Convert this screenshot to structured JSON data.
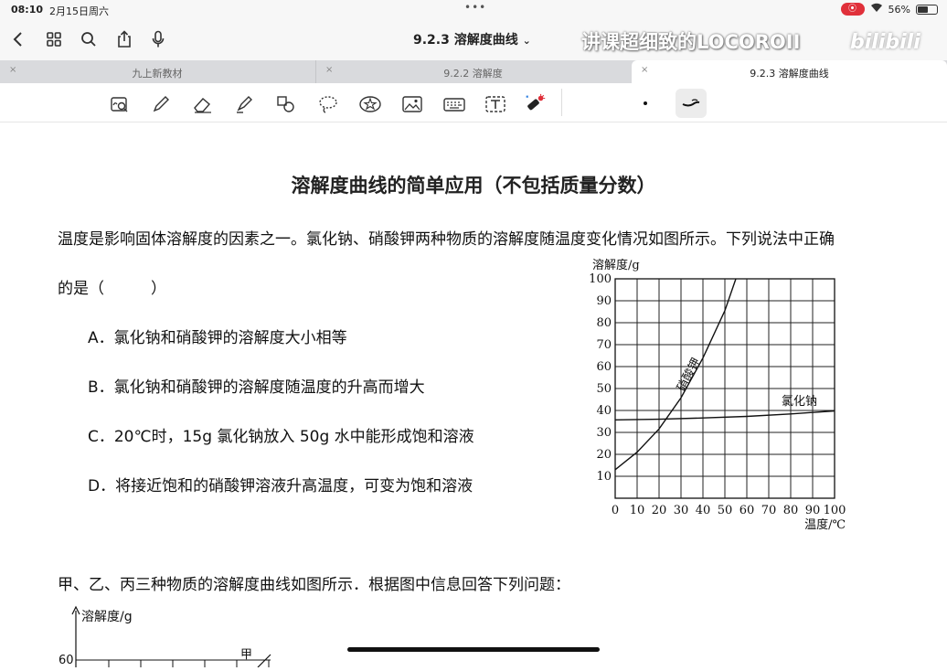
{
  "status": {
    "time": "08:10",
    "date": "2月15日周六",
    "battery": "56%",
    "battery_level": 0.56,
    "dots": "•••"
  },
  "nav": {
    "title": "9.2.3 溶解度曲线",
    "title_caret": "⌄",
    "watermark": "讲课超细致的LOCOROII",
    "bili": "bilibili"
  },
  "tabs": [
    {
      "label": "九上新教材",
      "active": false
    },
    {
      "label": "9.2.2 溶解度",
      "active": false
    },
    {
      "label": "9.2.3 溶解度曲线",
      "active": true
    }
  ],
  "tab_close": "×",
  "toolbar": {
    "tools": [
      "zoom-select-icon",
      "pen-icon",
      "eraser-icon",
      "highlighter-icon",
      "shapes-icon",
      "lasso-icon",
      "sticker-icon",
      "image-icon",
      "keyboard-icon",
      "text-icon",
      "laser-pointer-icon"
    ]
  },
  "document": {
    "title": "溶解度曲线的简单应用（不包括质量分数）",
    "question1": {
      "stem_line1": "温度是影响固体溶解度的因素之一。氯化钠、硝酸钾两种物质的溶解度随温度变化情况如图所示。下列说法中正确",
      "stem_line2": "的是（　　　）",
      "options": [
        "A．氯化钠和硝酸钾的溶解度大小相等",
        "B．氯化钠和硝酸钾的溶解度随温度的升高而增大",
        "C．20℃时，15g 氯化钠放入 50g 水中能形成饱和溶液",
        "D．将接近饱和的硝酸钾溶液升高温度，可变为饱和溶液"
      ]
    },
    "question2": {
      "stem": "甲、乙、丙三种物质的溶解度曲线如图所示．根据图中信息回答下列问题："
    }
  },
  "chart_data": [
    {
      "type": "line",
      "ylabel": "溶解度/g",
      "xlabel": "温度/℃",
      "xlim": [
        0,
        100
      ],
      "ylim": [
        0,
        100
      ],
      "x_ticks": [
        "0",
        "10",
        "20",
        "30",
        "40",
        "50",
        "60",
        "70",
        "80",
        "90",
        "100"
      ],
      "y_ticks": [
        "10",
        "20",
        "30",
        "40",
        "50",
        "60",
        "70",
        "80",
        "90",
        "100"
      ],
      "grid": true,
      "series": [
        {
          "name": "硝酸钾",
          "x": [
            0,
            10,
            20,
            30,
            40,
            50,
            55
          ],
          "y": [
            13,
            21,
            31.6,
            45.8,
            63.9,
            85.5,
            100
          ]
        },
        {
          "name": "氯化钠",
          "x": [
            0,
            20,
            40,
            60,
            80,
            100
          ],
          "y": [
            35.7,
            36,
            36.6,
            37.3,
            38.4,
            39.8
          ]
        }
      ]
    },
    {
      "type": "line",
      "ylabel": "溶解度/g",
      "y_ticks": [
        "60"
      ],
      "series": [
        {
          "name": "甲"
        }
      ]
    }
  ]
}
